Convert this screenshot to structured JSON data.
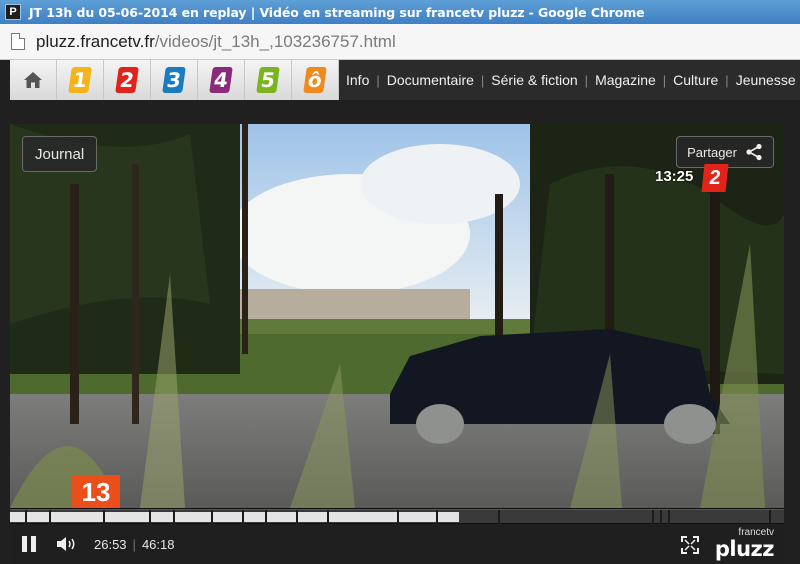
{
  "window": {
    "title": "JT 13h du 05-06-2014 en replay | Vidéo en streaming sur francetv pluzz - Google Chrome",
    "app_icon": "P"
  },
  "address_bar": {
    "url_host": "pluzz.francetv.fr",
    "url_path": "/videos/jt_13h_,103236757.html"
  },
  "site_nav": {
    "channels": [
      {
        "label": "1",
        "color": "#f6b31a"
      },
      {
        "label": "2",
        "color": "#e2231a"
      },
      {
        "label": "3",
        "color": "#1a7bc0"
      },
      {
        "label": "4",
        "color": "#8a2a7a"
      },
      {
        "label": "5",
        "color": "#7ab51d"
      },
      {
        "label": "ô",
        "color": "#f08a1d"
      }
    ],
    "menu": [
      "Info",
      "Documentaire",
      "Série & fiction",
      "Magazine",
      "Culture",
      "Jeunesse"
    ]
  },
  "player": {
    "program_button": "Journal",
    "share_button": "Partager",
    "overlay_clock": "13:25",
    "channel_logo": "2",
    "corner_logo": "13",
    "current_time": "26:53",
    "duration": "46:18",
    "progress_fraction": 0.58,
    "brand_small": "francetv",
    "brand_big": "pluzz"
  }
}
